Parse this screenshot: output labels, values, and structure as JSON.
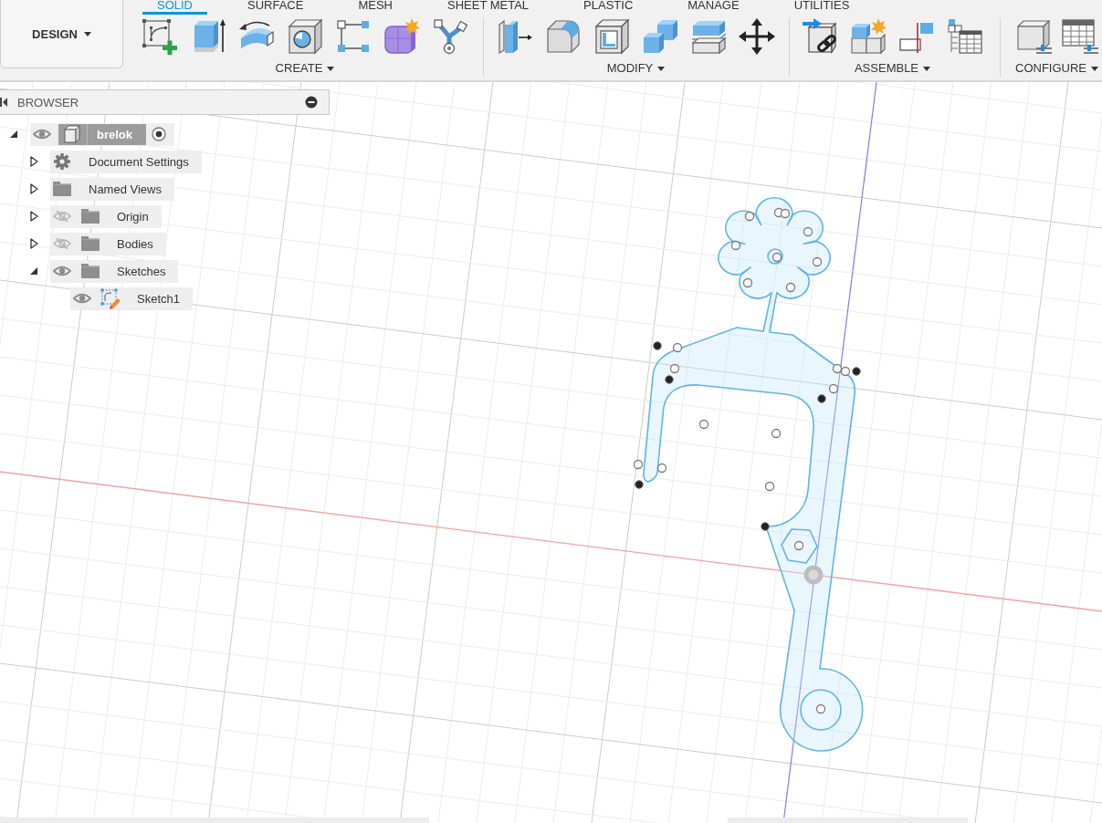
{
  "workspace_button": {
    "label": "DESIGN"
  },
  "tabs": [
    {
      "label": "SOLID",
      "selected": true
    },
    {
      "label": "SURFACE",
      "selected": false
    },
    {
      "label": "MESH",
      "selected": false
    },
    {
      "label": "SHEET METAL",
      "selected": false
    },
    {
      "label": "PLASTIC",
      "selected": false
    },
    {
      "label": "MANAGE",
      "selected": false
    },
    {
      "label": "UTILITIES",
      "selected": false
    }
  ],
  "toolbar_groups": [
    {
      "label": "CREATE"
    },
    {
      "label": "MODIFY"
    },
    {
      "label": "ASSEMBLE"
    },
    {
      "label": "CONFIGURE"
    }
  ],
  "browser": {
    "title": "BROWSER",
    "tree": [
      {
        "label": "brelok",
        "kind": "component",
        "expanded": true,
        "visible": true,
        "active": true,
        "children": [
          {
            "label": "Document Settings",
            "kind": "settings",
            "expanded": false
          },
          {
            "label": "Named Views",
            "kind": "folder",
            "expanded": false
          },
          {
            "label": "Origin",
            "kind": "folder",
            "expanded": false,
            "visible": false
          },
          {
            "label": "Bodies",
            "kind": "folder",
            "expanded": false,
            "visible": false
          },
          {
            "label": "Sketches",
            "kind": "folder",
            "expanded": true,
            "visible": true,
            "children": [
              {
                "label": "Sketch1",
                "kind": "sketch",
                "visible": true
              }
            ]
          }
        ]
      }
    ]
  }
}
